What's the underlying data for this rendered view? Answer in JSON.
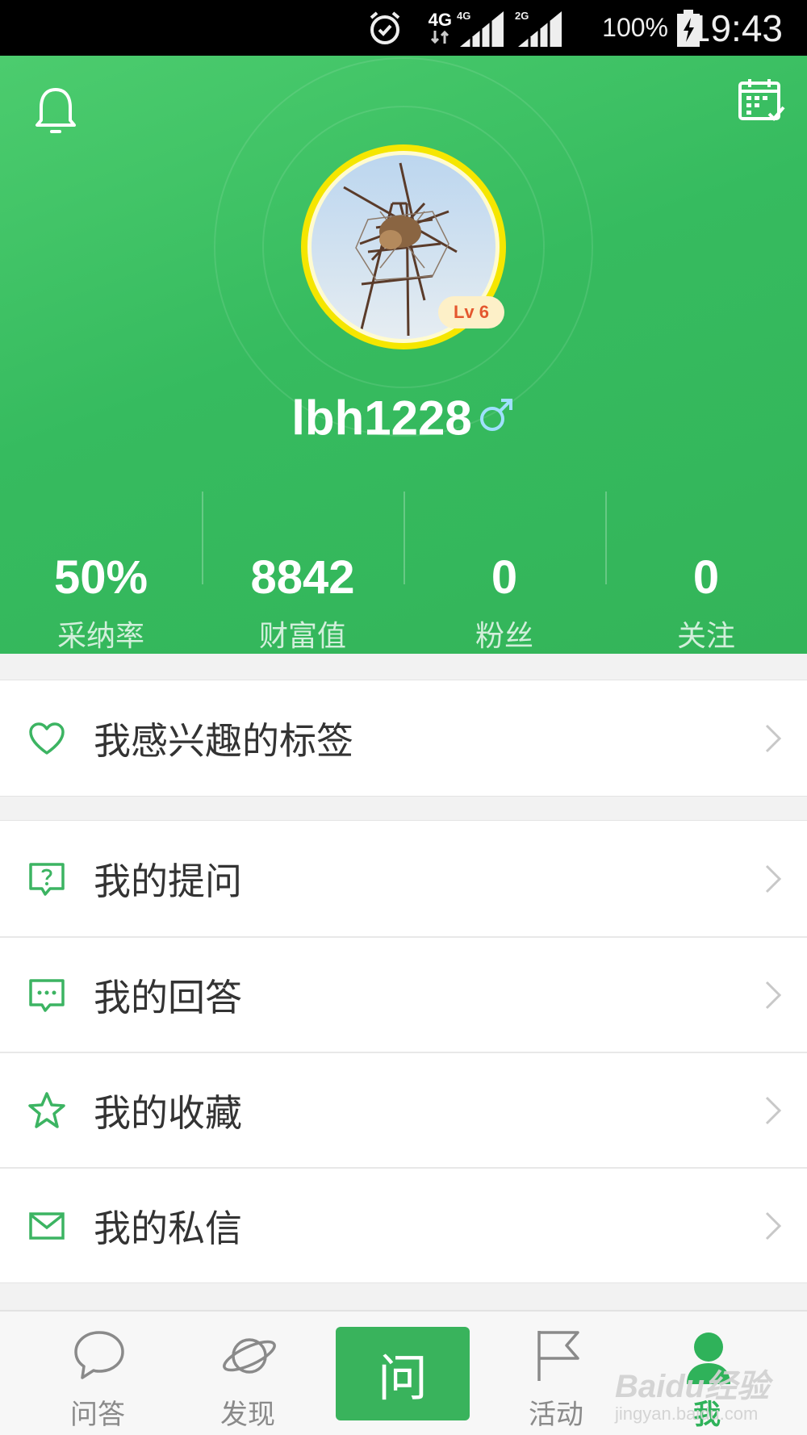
{
  "status_bar": {
    "network": "4G",
    "signal1_label": "4G",
    "signal2_label": "2G",
    "battery_percent": "100%",
    "time": "19:43"
  },
  "header": {
    "level_badge": "Lv 6",
    "username": "lbh1228",
    "gender_symbol": "♂",
    "stats": [
      {
        "value": "50%",
        "label": "采纳率"
      },
      {
        "value": "8842",
        "label": "财富值"
      },
      {
        "value": "0",
        "label": "粉丝"
      },
      {
        "value": "0",
        "label": "关注"
      }
    ]
  },
  "menu": {
    "group1": [
      {
        "label": "我感兴趣的标签",
        "icon": "heart-icon"
      }
    ],
    "group2": [
      {
        "label": "我的提问",
        "icon": "question-bubble-icon"
      },
      {
        "label": "我的回答",
        "icon": "answer-bubble-icon"
      },
      {
        "label": "我的收藏",
        "icon": "star-icon"
      },
      {
        "label": "我的私信",
        "icon": "mail-icon"
      }
    ]
  },
  "bottom_nav": {
    "items": [
      {
        "label": "问答",
        "icon": "chat-bubble-icon"
      },
      {
        "label": "发现",
        "icon": "planet-icon"
      },
      {
        "label": "问",
        "icon": "ask-button"
      },
      {
        "label": "活动",
        "icon": "flag-icon"
      },
      {
        "label": "我",
        "icon": "person-icon"
      }
    ],
    "active_index": 4
  },
  "watermark": {
    "line1": "Baidu经验",
    "line2": "jingyan.baidu.com"
  },
  "colors": {
    "primary_green": "#36bb5f",
    "level_badge_text": "#e4572e",
    "avatar_ring": "#f5e600"
  }
}
